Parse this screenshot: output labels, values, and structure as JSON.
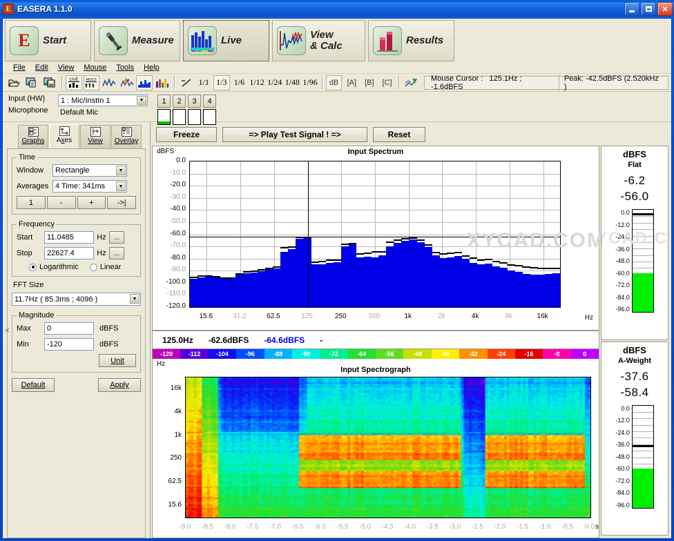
{
  "window": {
    "title": "EASERA 1.1.0",
    "icon_letter": "E",
    "buttons": {
      "minimize": "minimize-icon",
      "maximize": "maximize-icon",
      "close": "close-icon"
    }
  },
  "nav": [
    {
      "label": "Start",
      "icon": "easera-logo-icon",
      "selected": false
    },
    {
      "label": "Measure",
      "icon": "microphone-icon",
      "selected": false
    },
    {
      "label": "Live",
      "icon": "bar-meter-icon",
      "selected": true
    },
    {
      "label": "View",
      "label2": "& Calc",
      "icon": "waveform-icon",
      "selected": false
    },
    {
      "label": "Results",
      "icon": "bar-chart-icon",
      "selected": false
    }
  ],
  "menubar": [
    "File",
    "Edit",
    "View",
    "Mouse",
    "Tools",
    "Help"
  ],
  "toolbar": {
    "icons": [
      "open-folder-icon",
      "copy-image-icon",
      "save-image-icon",
      "live-icon",
      "hold-icon",
      "curve-icon",
      "curve-peak-icon",
      "filled-spectrum-icon",
      "color-bars-icon"
    ],
    "fractions": [
      "1/1",
      "1/3",
      "1/6",
      "1/12",
      "1/24",
      "1/48",
      "1/96"
    ],
    "no_smoothing": "no-smoothing-icon",
    "selected_fraction": "1/3",
    "weights": [
      "dB",
      "[A]",
      "[B]",
      "[C]"
    ],
    "selected_weight": "dB",
    "overlay_icon": "overlay-curves-icon",
    "mouse_cursor_label": "Mouse Cursor :",
    "mouse_cursor_value": "125.1Hz ; -1.6dBFS",
    "peak_text": "Peak: -42.5dBFS (2.520kHz )"
  },
  "input": {
    "hw_label": "Input (HW)",
    "hw_value": "1 : Mic/InstIn 1",
    "mic_label": "Microphone",
    "mic_value": "Default Mic",
    "channels": [
      "1",
      "2",
      "3",
      "4"
    ],
    "channel_levels": [
      8,
      0,
      0,
      0
    ]
  },
  "tabs": [
    {
      "label": "Graphs",
      "accel": "G",
      "icon": "graphs-icon",
      "selected": false
    },
    {
      "label": "Axes",
      "accel": "x",
      "icon": "axes-icon",
      "selected": true
    },
    {
      "label": "View",
      "accel": "V",
      "icon": "view-icon",
      "selected": false
    },
    {
      "label": "Overlay",
      "accel": "O",
      "icon": "overlay-icon",
      "selected": false
    }
  ],
  "settings": {
    "time": {
      "legend": "Time",
      "window_label": "Window",
      "window_value": "Rectangle",
      "averages_label": "Averages",
      "averages_value": "4   Time: 341ms",
      "buttons": [
        "1",
        "-",
        "+",
        "->|"
      ]
    },
    "frequency": {
      "legend": "Frequency",
      "start_label": "Start",
      "start_value": "11.0485",
      "stop_label": "Stop",
      "stop_value": "22627.4",
      "unit": "Hz",
      "ellipsis": "...",
      "scale_options": [
        "Logarithmic",
        "Linear"
      ],
      "scale_selected": "Logarithmic"
    },
    "fft": {
      "label": "FFT Size",
      "value": "11.7Hz ( 85.3ms ; 4096 )"
    },
    "magnitude": {
      "legend": "Magnitude",
      "max_label": "Max",
      "max_value": "0",
      "min_label": "Min",
      "min_value": "-120",
      "unit": "dBFS",
      "unit_button": "Unit"
    },
    "default_button": "Default",
    "apply_button": "Apply",
    "collapse_handle": "<"
  },
  "actions": {
    "freeze": "Freeze",
    "play": "=>  Play Test Signal !  =>",
    "reset": "Reset"
  },
  "readout": {
    "freq": "125.0Hz",
    "value1": "-62.6dBFS",
    "value2": "-64.6dBFS",
    "value3": "-"
  },
  "colorbar": {
    "labels": [
      "-120",
      "-112",
      "-104",
      "-96",
      "-88",
      "-80",
      "-72",
      "-64",
      "-56",
      "-48",
      "-40",
      "-32",
      "-24",
      "-16",
      "-8",
      "0"
    ],
    "colors": [
      "#bb00bb",
      "#5500dd",
      "#1010ee",
      "#0050ff",
      "#00b0ff",
      "#00f0e0",
      "#00f090",
      "#20e030",
      "#60dd20",
      "#c8e000",
      "#ffee00",
      "#ff9000",
      "#ff4000",
      "#e00000",
      "#ff00aa",
      "#c000ff"
    ]
  },
  "meters": [
    {
      "unit": "dBFS",
      "weighting": "Flat",
      "value1": "-6.2",
      "value2": "-56.0",
      "scale": [
        "0.0",
        "-12.0",
        "-24.0",
        "-36.0",
        "-48.0",
        "-60.0",
        "-72.0",
        "-84.0",
        "-96.0"
      ],
      "green_from": -60,
      "needle_db": -3,
      "color": "#00ee00"
    },
    {
      "unit": "dBFS",
      "weighting": "A-Weight",
      "value1": "-37.6",
      "value2": "-58.4",
      "scale": [
        "0.0",
        "-12.0",
        "-24.0",
        "-36.0",
        "-48.0",
        "-60.0",
        "-72.0",
        "-84.0",
        "-96.0"
      ],
      "green_from": -60,
      "needle_db": -37,
      "color": "#00ee00"
    }
  ],
  "watermark": "XYCAD.COM",
  "chart_data": [
    {
      "type": "bar",
      "title": "Input Spectrum",
      "xlabel": "Hz",
      "ylabel": "dBFS",
      "ylim": [
        -120,
        0
      ],
      "yticks": [
        0.0,
        -10.0,
        -20.0,
        -30.0,
        -40.0,
        -50.0,
        -60.0,
        -70.0,
        -80.0,
        -90.0,
        -100.0,
        -110.0,
        -120.0
      ],
      "ytick_labels": [
        "0.0",
        "-10.0",
        "-20.0",
        "-30.0",
        "-40.0",
        "-50.0",
        "-60.0",
        "-70.0",
        "-80.0",
        "-90.0",
        "-100.0",
        "-110.0",
        "-120.0"
      ],
      "xticks": [
        "15.6",
        "31.2",
        "62.5",
        "125",
        "250",
        "500",
        "1k",
        "2k",
        "4k",
        "8k",
        "16k"
      ],
      "xtick_major": [
        "15.6",
        "62.5",
        "250",
        "1k",
        "4k",
        "16k"
      ],
      "grid": true,
      "cursor_freq": "125.0Hz",
      "cursor_value_dbfs": -62.6,
      "peak_hold_line_dbfs": -62.0,
      "bars_dbfs": [
        -96.5,
        -95.5,
        -95.0,
        -95.5,
        -96.0,
        -96.5,
        -93.5,
        -92.0,
        -91.5,
        -90.5,
        -89.0,
        -88.0,
        -74.5,
        -72.5,
        -63.5,
        -63.0,
        -85.0,
        -84.5,
        -83.5,
        -83.0,
        -70.0,
        -68.0,
        -79.0,
        -78.5,
        -79.0,
        -77.5,
        -70.0,
        -67.0,
        -65.5,
        -64.0,
        -66.5,
        -70.5,
        -77.5,
        -79.5,
        -79.0,
        -78.0,
        -80.0,
        -83.5,
        -85.0,
        -84.0,
        -86.5,
        -87.5,
        -90.0,
        -91.0,
        -92.5,
        -93.0,
        -93.5,
        -92.5,
        -92.0
      ],
      "peak_dbfs": [
        -95.0,
        -94.0,
        -94.0,
        -94.5,
        -95.5,
        -95.5,
        -92.0,
        -90.5,
        -90.0,
        -89.0,
        -87.5,
        -86.5,
        -70.5,
        -70.0,
        -62.0,
        -62.0,
        -82.5,
        -82.0,
        -81.0,
        -80.5,
        -67.5,
        -67.0,
        -75.5,
        -75.0,
        -74.0,
        -74.0,
        -66.0,
        -64.5,
        -63.0,
        -62.5,
        -64.5,
        -68.0,
        -74.5,
        -75.5,
        -75.0,
        -74.5,
        -77.5,
        -79.0,
        -80.5,
        -80.0,
        -82.0,
        -83.0,
        -84.5,
        -85.5,
        -86.5,
        -87.0,
        -87.5,
        -87.5,
        -87.5
      ]
    },
    {
      "type": "heatmap",
      "title": "Input Spectrograph",
      "ylabel": "Hz",
      "xlabel": "s",
      "yticks": [
        "16k",
        "4k",
        "1k",
        "250",
        "62.5",
        "15.6"
      ],
      "xticks": [
        "-9.0",
        "-8.5",
        "-8.0",
        "-7.5",
        "-7.0",
        "-6.5",
        "-6.0",
        "-5.5",
        "-5.0",
        "-4.5",
        "-4.0",
        "-3.5",
        "-3.0",
        "-2.5",
        "-2.0",
        "-1.5",
        "-1.0",
        "-0.5",
        "0.0"
      ],
      "colormap_db_range": [
        -120,
        0
      ]
    }
  ]
}
